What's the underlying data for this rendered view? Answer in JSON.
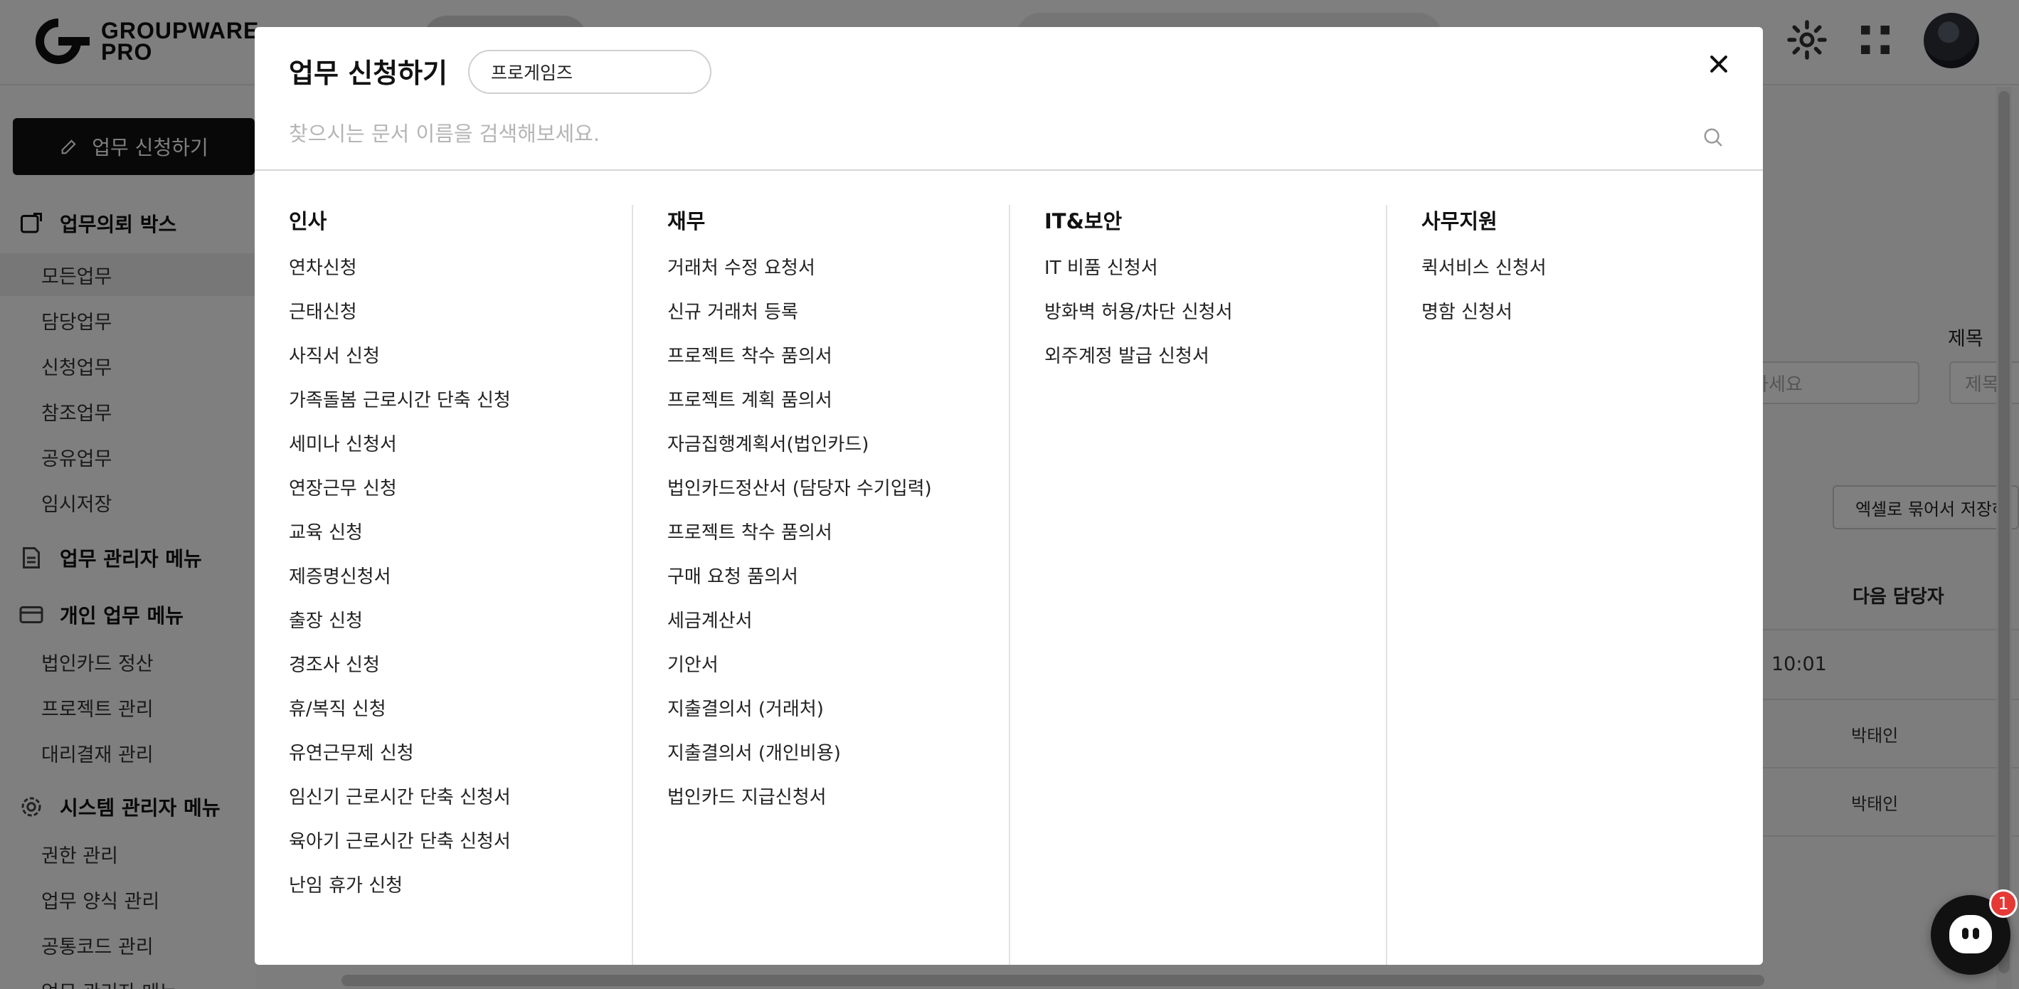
{
  "app": {
    "logo_line1": "GROUPWARE",
    "logo_line2": "PRO"
  },
  "sidebar": {
    "apply_label": "업무 신청하기",
    "sections": [
      {
        "label": "업무의뢰 박스",
        "icon": "inbox-icon"
      },
      {
        "label": "업무 관리자 메뉴",
        "icon": "document-icon"
      },
      {
        "label": "개인 업무 메뉴",
        "icon": "card-icon"
      },
      {
        "label": "시스템 관리자 메뉴",
        "icon": "gear-icon"
      }
    ],
    "inbox_items": [
      "모든업무",
      "담당업무",
      "신청업무",
      "참조업무",
      "공유업무",
      "임시저장"
    ],
    "personal_items": [
      "법인카드 정산",
      "프로젝트 관리",
      "대리결재 관리"
    ],
    "system_items": [
      "권한 관리",
      "업무 양식 관리",
      "공통코드 관리",
      "업무 관리자 메뉴"
    ]
  },
  "main": {
    "title_label": "제목",
    "title_placeholder": "를 입력하세요",
    "title_placeholder2": "제목",
    "excel_button": "엑셀로 묶어서 저장하",
    "next_assignee_header": "다음 담당자",
    "rows": [
      {
        "time": "10:01",
        "assignee": ""
      },
      {
        "time": "",
        "assignee": "박태인"
      },
      {
        "time": "",
        "assignee": "박태인"
      }
    ]
  },
  "chat": {
    "badge": "1"
  },
  "modal": {
    "title": "업무 신청하기",
    "company": "프로게임즈",
    "search_placeholder": "찾으시는 문서 이름을 검색해보세요.",
    "categories": [
      {
        "name": "인사",
        "items": [
          "연차신청",
          "근태신청",
          "사직서 신청",
          "가족돌봄 근로시간 단축 신청",
          "세미나 신청서",
          "연장근무 신청",
          "교육 신청",
          "제증명신청서",
          "출장 신청",
          "경조사 신청",
          "휴/복직 신청",
          "유연근무제 신청",
          "임신기 근로시간 단축 신청서",
          "육아기 근로시간 단축 신청서",
          "난임 휴가 신청"
        ]
      },
      {
        "name": "재무",
        "items": [
          "거래처 수정 요청서",
          "신규 거래처 등록",
          "프로젝트 착수 품의서",
          "프로젝트 계획 품의서",
          "자금집행계획서(법인카드)",
          "법인카드정산서 (담당자 수기입력)",
          "프로젝트 착수 품의서",
          "구매 요청 품의서",
          "세금계산서",
          "기안서",
          "지출결의서 (거래처)",
          "지출결의서 (개인비용)",
          "법인카드 지급신청서"
        ]
      },
      {
        "name": "IT&보안",
        "items": [
          "IT 비품 신청서",
          "방화벽 허용/차단 신청서",
          "외주계정 발급 신청서"
        ]
      },
      {
        "name": "사무지원",
        "items": [
          "퀵서비스 신청서",
          "명함 신청서"
        ]
      }
    ]
  }
}
